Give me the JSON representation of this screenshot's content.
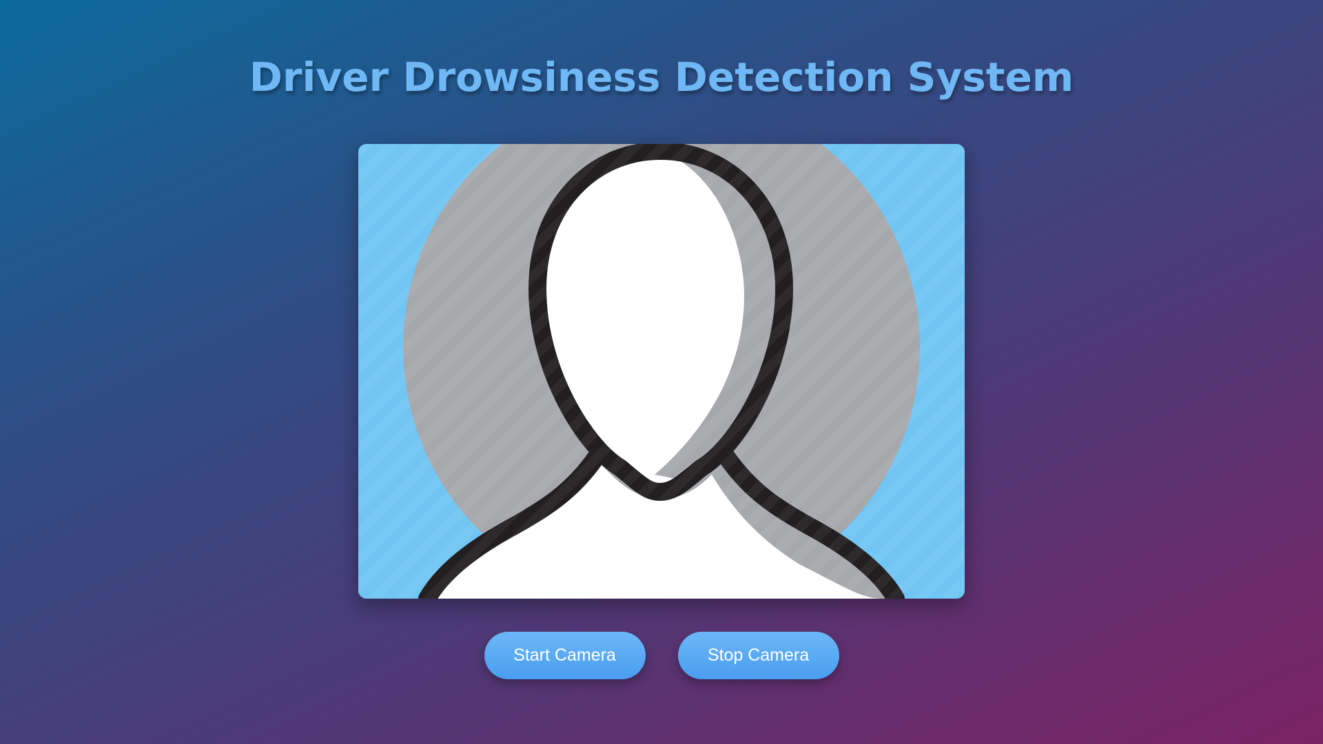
{
  "page": {
    "title": "Driver Drowsiness Detection System"
  },
  "video": {
    "placeholder_icon": "person-silhouette-icon",
    "background_color": "#71c5f3"
  },
  "controls": {
    "start_label": "Start Camera",
    "stop_label": "Stop Camera"
  },
  "colors": {
    "title": "#6fb8f5",
    "button": "#5aa9f3",
    "button_text": "#ffffff"
  }
}
